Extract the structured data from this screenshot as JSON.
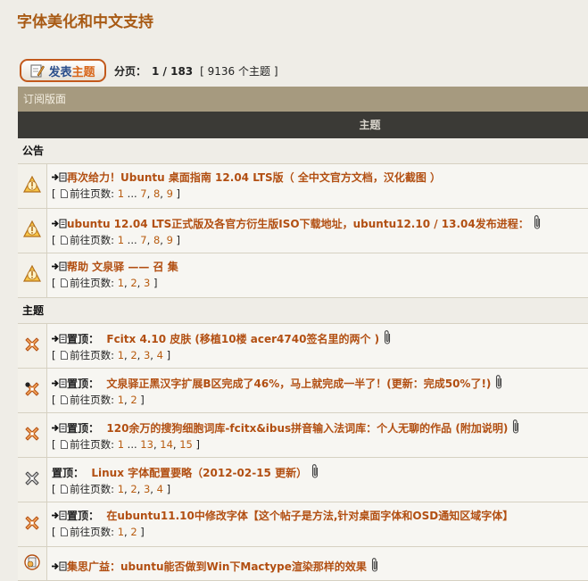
{
  "forum": {
    "title": "字体美化和中文支持"
  },
  "toolbar": {
    "post_label_a": "发表",
    "post_label_b": "主题",
    "pages_label": "分页：",
    "pages_value": "1 / 183",
    "topic_count": "[ 9136 个主题 ]"
  },
  "subscribe_label": "订阅版面",
  "column_header": "主题",
  "sections": {
    "announcements": "公告",
    "topics": "主题"
  },
  "goto_label": "前往页数:",
  "ellipsis": "...",
  "topics": [
    {
      "type": "announce",
      "prefix": "",
      "title": "再次给力！Ubuntu 桌面指南 12.04 LTS版（ 全中文官方文档，汉化截图 ）",
      "attachment": false,
      "pages": [
        "1",
        "...",
        "7",
        "8",
        "9"
      ]
    },
    {
      "type": "announce",
      "prefix": "",
      "title": "ubuntu 12.04 LTS正式版及各官方衍生版ISO下载地址，ubuntu12.10 / 13.04发布进程：",
      "attachment": true,
      "pages": [
        "1",
        "...",
        "7",
        "8",
        "9"
      ]
    },
    {
      "type": "announce",
      "prefix": "",
      "title": "帮助 文泉驿 —— 召 集",
      "attachment": false,
      "pages": [
        "1",
        "2",
        "3"
      ]
    },
    {
      "type": "sticky",
      "prefix": "置顶：",
      "title": "Fcitx 4.10 皮肤 (移植10楼 acer4740签名里的两个 )",
      "attachment": true,
      "pages": [
        "1",
        "2",
        "3",
        "4"
      ]
    },
    {
      "type": "sticky-dark",
      "prefix": "置顶：",
      "title": "文泉驿正黑汉字扩展B区完成了46%，马上就完成一半了！(更新：完成50%了!)",
      "attachment": true,
      "pages": [
        "1",
        "2"
      ]
    },
    {
      "type": "sticky",
      "prefix": "置顶：",
      "title": "120余万的搜狗细胞词库-fcitx&ibus拼音输入法词库：个人无聊的作品 (附加说明)",
      "attachment": true,
      "pages": [
        "1",
        "...",
        "13",
        "14",
        "15"
      ]
    },
    {
      "type": "sticky-gray",
      "prefix": "置顶：",
      "title": "Linux 字体配置要略（2012-02-15 更新）",
      "attachment": true,
      "noarrow": true,
      "pages": [
        "1",
        "2",
        "3",
        "4"
      ]
    },
    {
      "type": "sticky",
      "prefix": "置顶：",
      "title": "在ubuntu11.10中修改字体【这个帖子是方法,针对桌面字体和OSD通知区域字体】",
      "attachment": false,
      "pages": [
        "1",
        "2"
      ]
    },
    {
      "type": "topic",
      "prefix": "",
      "title": "集思广益：ubuntu能否做到Win下Mactype渲染那样的效果",
      "attachment": true,
      "pages": []
    }
  ]
}
